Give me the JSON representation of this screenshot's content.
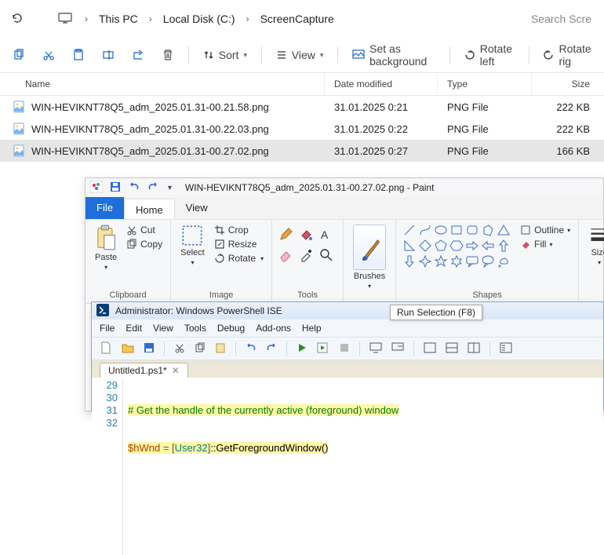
{
  "explorer": {
    "search_placeholder": "Search Scre",
    "breadcrumbs": [
      "This PC",
      "Local Disk (C:)",
      "ScreenCapture"
    ],
    "toolbar": {
      "sort": "Sort",
      "view": "View",
      "set_bg": "Set as background",
      "rotate_left": "Rotate left",
      "rotate_right": "Rotate rig"
    },
    "headers": {
      "name": "Name",
      "date": "Date modified",
      "type": "Type",
      "size": "Size"
    },
    "rows": [
      {
        "name": "WIN-HEVIKNT78Q5_adm_2025.01.31-00.21.58.png",
        "date": "31.01.2025 0:21",
        "type": "PNG File",
        "size": "222 KB",
        "selected": false
      },
      {
        "name": "WIN-HEVIKNT78Q5_adm_2025.01.31-00.22.03.png",
        "date": "31.01.2025 0:22",
        "type": "PNG File",
        "size": "222 KB",
        "selected": false
      },
      {
        "name": "WIN-HEVIKNT78Q5_adm_2025.01.31-00.27.02.png",
        "date": "31.01.2025 0:27",
        "type": "PNG File",
        "size": "166 KB",
        "selected": true
      }
    ]
  },
  "paint": {
    "title": "WIN-HEVIKNT78Q5_adm_2025.01.31-00.27.02.png - Paint",
    "tabs": {
      "file": "File",
      "home": "Home",
      "view": "View"
    },
    "clipboard": {
      "paste": "Paste",
      "cut": "Cut",
      "copy": "Copy",
      "label": "Clipboard"
    },
    "image": {
      "select": "Select",
      "crop": "Crop",
      "resize": "Resize",
      "rotate": "Rotate",
      "label": "Image"
    },
    "tools": {
      "label": "Tools"
    },
    "brushes": {
      "label": "Brushes"
    },
    "shapes": {
      "outline": "Outline",
      "fill": "Fill",
      "label": "Shapes"
    },
    "size": {
      "label": "Size"
    }
  },
  "ise": {
    "title": "Administrator: Windows PowerShell ISE",
    "menu": [
      "File",
      "Edit",
      "View",
      "Tools",
      "Debug",
      "Add-ons",
      "Help"
    ],
    "tooltip": "Run Selection (F8)",
    "tab": "Untitled1.ps1*",
    "gutter": [
      "29",
      "30",
      "31",
      "32"
    ],
    "code": {
      "l29_comment": "# Get the handle of the currently active (foreground) window",
      "l30_var": "$hWnd",
      "l30_eq": " = ",
      "l30_br1": "[",
      "l30_type": "User32",
      "l30_br2": "]",
      "l30_call": "::GetForegroundWindow()"
    }
  }
}
